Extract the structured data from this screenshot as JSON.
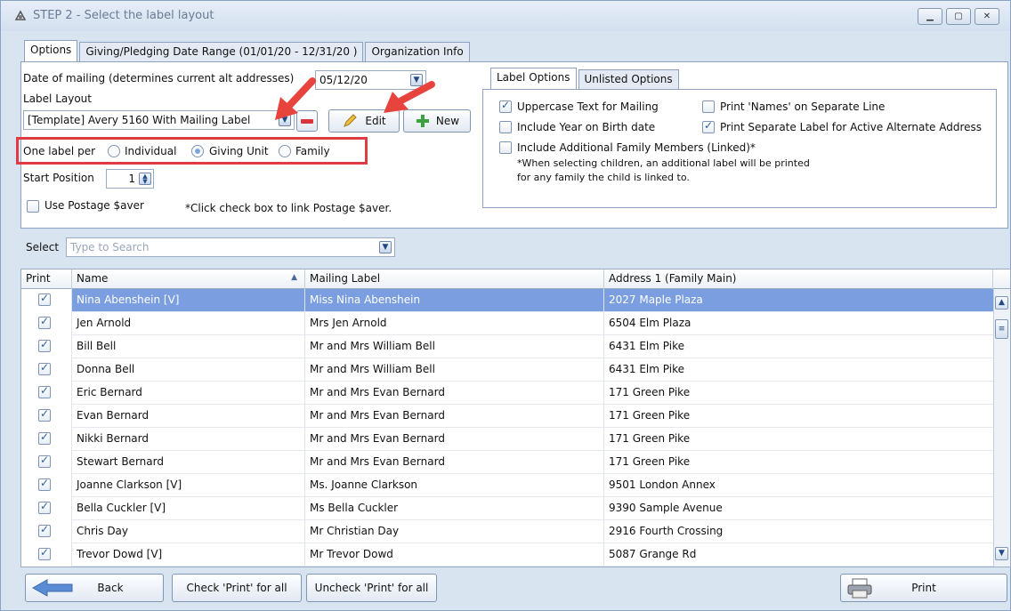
{
  "window": {
    "title": "STEP 2 - Select the label layout"
  },
  "tabs": [
    {
      "label": "Options"
    },
    {
      "label": "Giving/Pledging Date Range (01/01/20    - 12/31/20   )"
    },
    {
      "label": "Organization Info"
    }
  ],
  "options": {
    "date_label": "Date of mailing (determines current alt addresses)",
    "date_value": "05/12/20",
    "layout_label": "Label Layout",
    "layout_value": "[Template] Avery 5160 With Mailing Label",
    "edit_label": "Edit",
    "new_label": "New",
    "one_label_per": "One label per",
    "radio_individual": "Individual",
    "radio_giving_unit": "Giving Unit",
    "radio_family": "Family",
    "start_position_label": "Start Position",
    "start_position_value": "1",
    "postage_label": "Use Postage $aver",
    "postage_note": "*Click check box to link Postage $aver."
  },
  "label_options": {
    "tabs": [
      "Label Options",
      "Unlisted Options"
    ],
    "uppercase": "Uppercase Text for Mailing",
    "print_names": "Print 'Names' on Separate Line",
    "year_birth": "Include Year on Birth date",
    "separate_label": "Print Separate Label for Active Alternate Address",
    "additional_members": "Include Additional Family Members (Linked)*",
    "note1": "*When selecting children, an additional label will be printed",
    "note2": "for any family the child is linked to."
  },
  "select": {
    "label": "Select",
    "placeholder": "Type to Search"
  },
  "grid": {
    "headers": [
      "Print",
      "Name",
      "Mailing Label",
      "Address 1 (Family Main)"
    ],
    "rows": [
      {
        "name": "Nina Abenshein [V]",
        "label": "Miss Nina Abenshein",
        "address": "2027 Maple Plaza"
      },
      {
        "name": "Jen Arnold",
        "label": "Mrs Jen Arnold",
        "address": "6504 Elm Plaza"
      },
      {
        "name": "Bill Bell",
        "label": "Mr and Mrs William Bell",
        "address": "6431 Elm Pike"
      },
      {
        "name": "Donna Bell",
        "label": "Mr and Mrs William Bell",
        "address": "6431 Elm Pike"
      },
      {
        "name": "Eric Bernard",
        "label": "Mr and Mrs Evan Bernard",
        "address": "171 Green Pike"
      },
      {
        "name": "Evan Bernard",
        "label": "Mr and Mrs Evan Bernard",
        "address": "171 Green Pike"
      },
      {
        "name": "Nikki Bernard",
        "label": "Mr and Mrs Evan Bernard",
        "address": "171 Green Pike"
      },
      {
        "name": "Stewart Bernard",
        "label": "Mr and Mrs Evan Bernard",
        "address": "171 Green Pike"
      },
      {
        "name": "Joanne Clarkson [V]",
        "label": "Ms. Joanne Clarkson",
        "address": "9501 London Annex"
      },
      {
        "name": "Bella Cuckler [V]",
        "label": "Ms Bella Cuckler",
        "address": "9390 Sample Avenue"
      },
      {
        "name": "Chris Day",
        "label": "Mr Christian Day",
        "address": "2916 Fourth Crossing"
      },
      {
        "name": "Trevor Dowd [V]",
        "label": "Mr Trevor Dowd",
        "address": "5087 Grange Rd"
      }
    ]
  },
  "footer": {
    "back": "Back",
    "check_all": "Check 'Print' for all",
    "uncheck_all": "Uncheck 'Print' for all",
    "print": "Print"
  },
  "colors": {
    "selected_row": "#7a9ee0",
    "highlight_box": "#e03a44",
    "arrow": "#e8443e"
  }
}
